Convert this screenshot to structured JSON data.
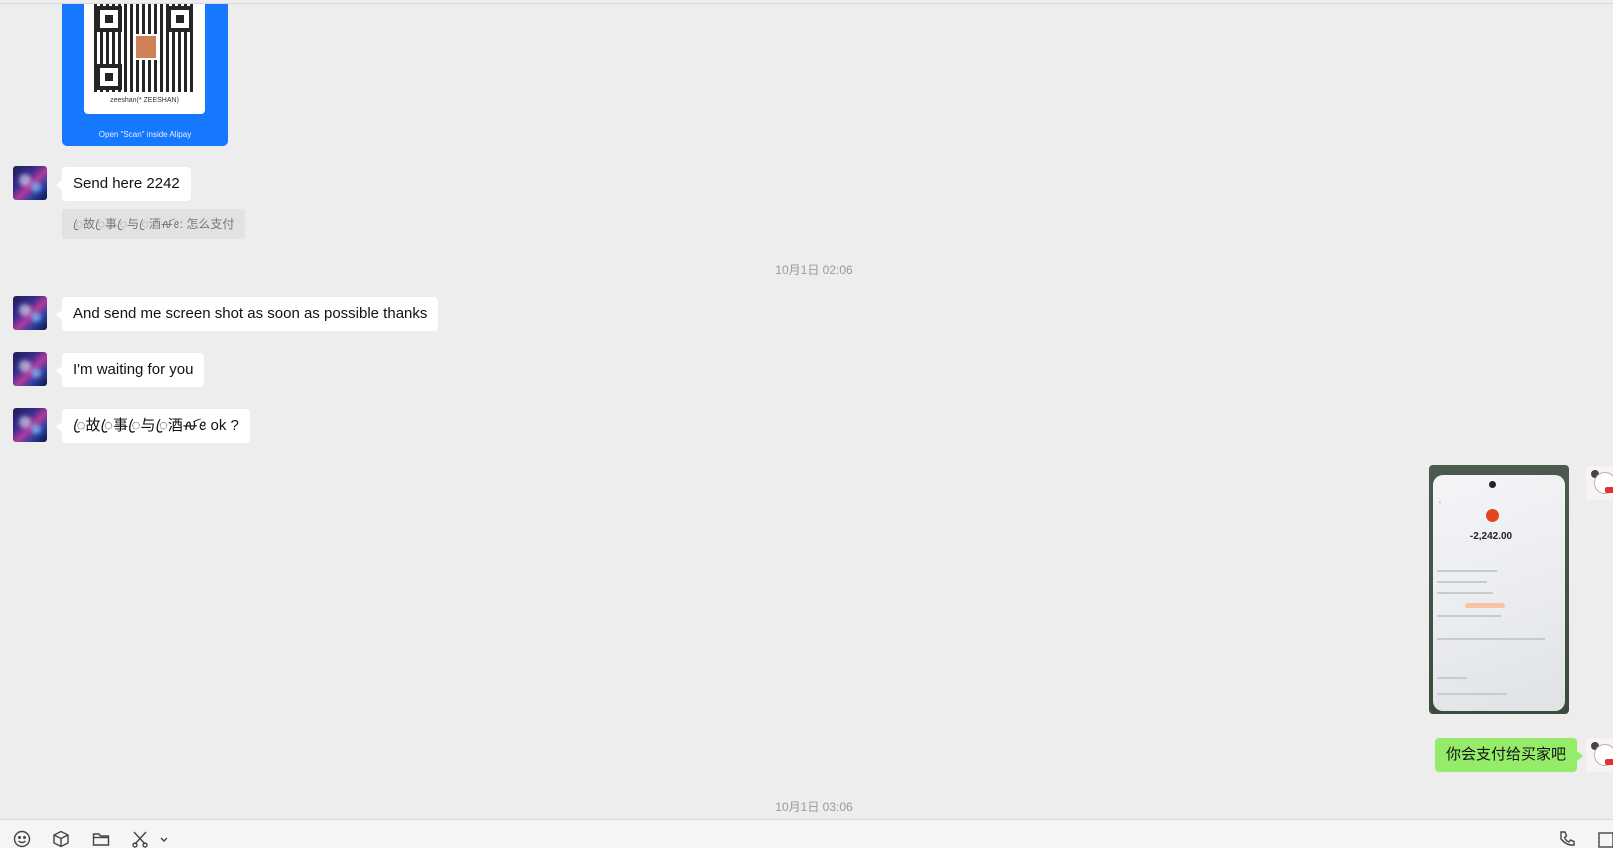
{
  "chat": {
    "qr_card": {
      "name": "zeeshan(* ZEESHAN)",
      "caption": "Open \"Scan\" inside Alipay"
    },
    "messages": [
      {
        "text": "Send here 2242"
      },
      {
        "quote": "ꦿ故ꦿ事ꦿ与ꦿ酒ꫛꫀ: 怎么支付"
      },
      {
        "text": "And send me screen shot as soon as possible thanks"
      },
      {
        "text": "I'm waiting for you"
      },
      {
        "text": "ꦿ故ꦿ事ꦿ与ꦿ酒ꫛꫀ ok ?"
      },
      {
        "text": "你会支付给买家吧"
      }
    ],
    "timestamps": [
      "10月1日 02:06",
      "10月1日 03:06"
    ],
    "screenshot_amount": "-2,242.00"
  },
  "toolbar": {
    "icons": [
      "emoji-icon",
      "box-icon",
      "folder-icon",
      "scissors-icon",
      "phone-icon",
      "window-icon"
    ]
  }
}
